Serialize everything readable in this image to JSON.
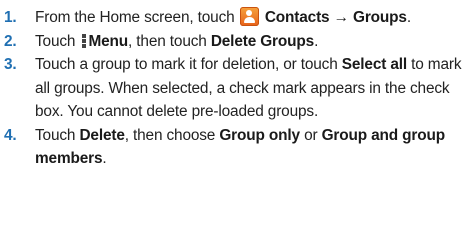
{
  "steps": [
    {
      "number": "1",
      "t1": "From the Home screen, touch ",
      "icon1": "contacts-app-icon",
      "b1": "Contacts",
      "arrow": "→",
      "b2": "Groups",
      "t2": "."
    },
    {
      "number": "2",
      "t1": "Touch ",
      "icon1": "menu-icon",
      "b1": "Menu",
      "t2": ", then touch ",
      "b2": "Delete Groups",
      "t3": "."
    },
    {
      "number": "3",
      "t1": "Touch a group to mark it for deletion, or touch ",
      "b1": "Select all",
      "t2": " to mark all groups. When selected, a check mark appears in the check box. You cannot delete pre-loaded groups."
    },
    {
      "number": "4",
      "t1": "Touch ",
      "b1": "Delete",
      "t2": ", then choose ",
      "b2": "Group only",
      "t3": " or ",
      "b3": "Group and group members",
      "t4": "."
    }
  ]
}
